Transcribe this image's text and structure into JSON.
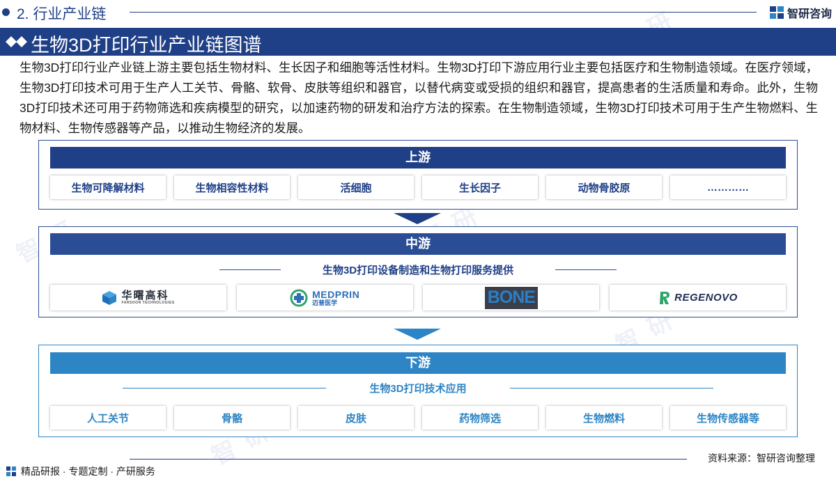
{
  "header": {
    "section": "2. 行业产业链",
    "brand_name": "智研咨询"
  },
  "banner": {
    "title": "生物3D打印行业产业链图谱"
  },
  "intro": "生物3D打印行业产业链上游主要包括生物材料、生长因子和细胞等活性材料。生物3D打印下游应用行业主要包括医疗和生物制造领域。在医疗领域，生物3D打印技术可用于生产人工关节、骨骼、软骨、皮肤等组织和器官，以替代病变或受损的组织和器官，提高患者的生活质量和寿命。此外，生物3D打印技术还可用于药物筛选和疾病模型的研究，以加速药物的研发和治疗方法的探索。在生物制造领域，生物3D打印技术可用于生产生物燃料、生物材料、生物传感器等产品，以推动生物经济的发展。",
  "upstream": {
    "title": "上游",
    "items": [
      "生物可降解材料",
      "生物相容性材料",
      "活细胞",
      "生长因子",
      "动物骨胶原",
      "…………"
    ]
  },
  "midstream": {
    "title": "中游",
    "subtitle": "生物3D打印设备制造和生物打印服务提供",
    "companies": [
      {
        "name": "华曙高科",
        "sub": "FARSOON TECHNOLOGIES"
      },
      {
        "name": "MEDPRIN",
        "sub": "迈普医学"
      },
      {
        "name": "BONE"
      },
      {
        "name": "REGENOVO"
      }
    ]
  },
  "downstream": {
    "title": "下游",
    "subtitle": "生物3D打印技术应用",
    "items": [
      "人工关节",
      "骨骼",
      "皮肤",
      "药物筛选",
      "生物燃料",
      "生物传感器等"
    ]
  },
  "source": "资料来源：智研咨询整理",
  "footer": "精品研报 · 专题定制 · 产研服务",
  "colors": {
    "navy": "#1f3f86",
    "mid_blue": "#2a4d96",
    "light_blue": "#2d85c5"
  }
}
